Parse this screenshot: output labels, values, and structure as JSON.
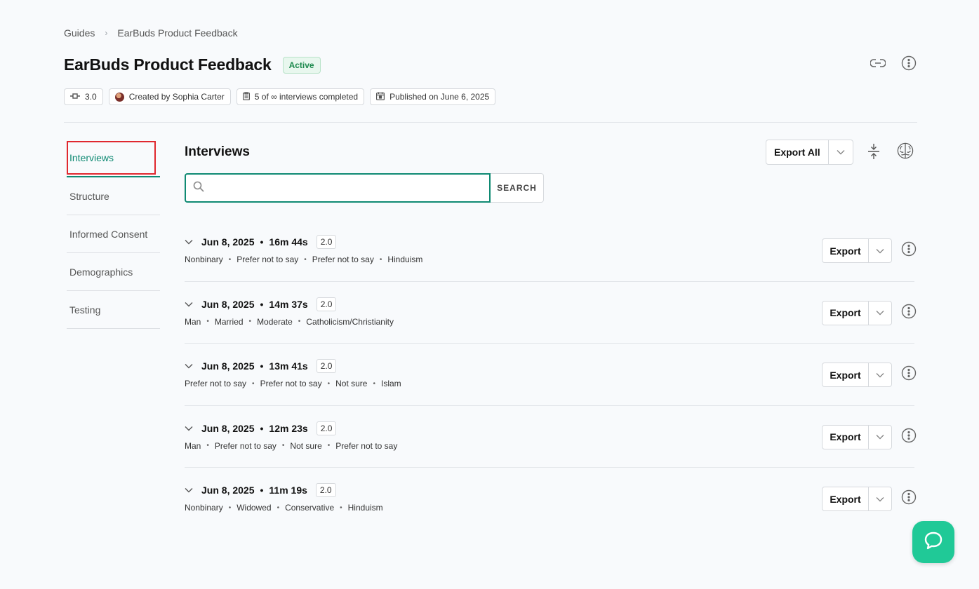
{
  "breadcrumb": {
    "root": "Guides",
    "current": "EarBuds Product Feedback"
  },
  "page": {
    "title": "EarBuds Product Feedback",
    "status": "Active"
  },
  "meta": {
    "version": "3.0",
    "creator": "Created by Sophia Carter",
    "progress": "5 of ∞ interviews completed",
    "published": "Published on June 6, 2025"
  },
  "sidenav": {
    "items": [
      {
        "label": "Interviews",
        "active": true
      },
      {
        "label": "Structure"
      },
      {
        "label": "Informed Consent"
      },
      {
        "label": "Demographics"
      },
      {
        "label": "Testing"
      }
    ]
  },
  "section": {
    "title": "Interviews",
    "export_all": "Export All"
  },
  "search": {
    "button": "SEARCH",
    "placeholder": "",
    "value": ""
  },
  "interviews": [
    {
      "date": "Jun 8, 2025",
      "duration": "16m 44s",
      "version": "2.0",
      "tags": [
        "Nonbinary",
        "Prefer not to say",
        "Prefer not to say",
        "Hinduism"
      ],
      "export": "Export"
    },
    {
      "date": "Jun 8, 2025",
      "duration": "14m 37s",
      "version": "2.0",
      "tags": [
        "Man",
        "Married",
        "Moderate",
        "Catholicism/Christianity"
      ],
      "export": "Export"
    },
    {
      "date": "Jun 8, 2025",
      "duration": "13m 41s",
      "version": "2.0",
      "tags": [
        "Prefer not to say",
        "Prefer not to say",
        "Not sure",
        "Islam"
      ],
      "export": "Export"
    },
    {
      "date": "Jun 8, 2025",
      "duration": "12m 23s",
      "version": "2.0",
      "tags": [
        "Man",
        "Prefer not to say",
        "Not sure",
        "Prefer not to say"
      ],
      "export": "Export"
    },
    {
      "date": "Jun 8, 2025",
      "duration": "11m 19s",
      "version": "2.0",
      "tags": [
        "Nonbinary",
        "Widowed",
        "Conservative",
        "Hinduism"
      ],
      "export": "Export"
    }
  ],
  "colors": {
    "accent": "#0f8a73",
    "status_green": "#1d8a4e",
    "fab": "#20c997",
    "highlight": "#e0282e"
  }
}
